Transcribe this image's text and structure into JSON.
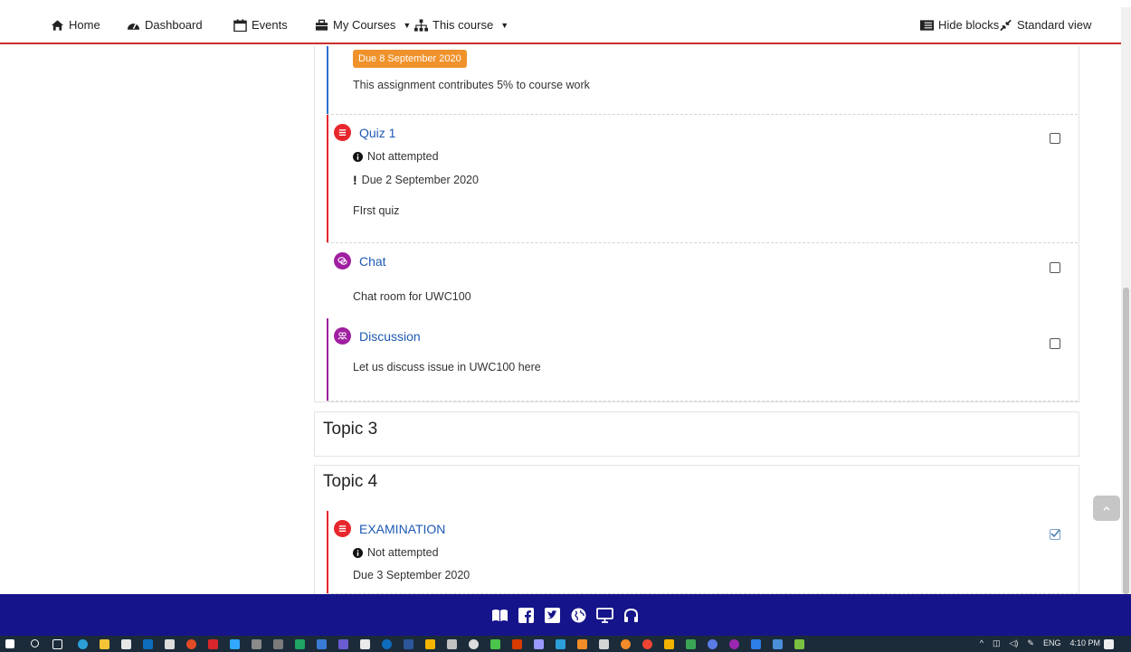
{
  "nav": {
    "home": "Home",
    "dashboard": "Dashboard",
    "events": "Events",
    "my_courses": "My Courses",
    "this_course": "This course",
    "hide_blocks": "Hide blocks",
    "standard_view": "Standard view"
  },
  "colors": {
    "nav_border": "#c9302c",
    "link": "#1e5ab4",
    "quiz_red": "#e8262d",
    "chat_purple": "#a01fa0",
    "assign_blue": "#2e6fd1",
    "footer": "#16148a",
    "badge_orange": "#f0922b"
  },
  "assignment": {
    "due_badge": "Due 8 September 2020",
    "description": "This assignment contributes 5% to course work"
  },
  "quiz1": {
    "icon": "quiz-icon",
    "title": "Quiz 1",
    "status": "Not attempted",
    "due": "Due 2 September 2020",
    "description": "FIrst quiz"
  },
  "chat": {
    "icon": "chat-icon",
    "title": "Chat",
    "description": "Chat room for UWC100"
  },
  "discussion": {
    "icon": "forum-icon",
    "title": "Discussion",
    "description": "Let us discuss issue in UWC100 here"
  },
  "topic3": {
    "title": "Topic 3"
  },
  "topic4": {
    "title": "Topic 4",
    "exam": {
      "icon": "quiz-icon",
      "title": "EXAMINATION",
      "status": "Not attempted",
      "due": "Due 3 September 2020"
    }
  },
  "footer_icons": [
    "book-icon",
    "facebook-icon",
    "twitter-icon",
    "globe-icon",
    "monitor-icon",
    "headphones-icon"
  ],
  "tray": {
    "lang": "ENG",
    "time": "4:10 PM"
  }
}
